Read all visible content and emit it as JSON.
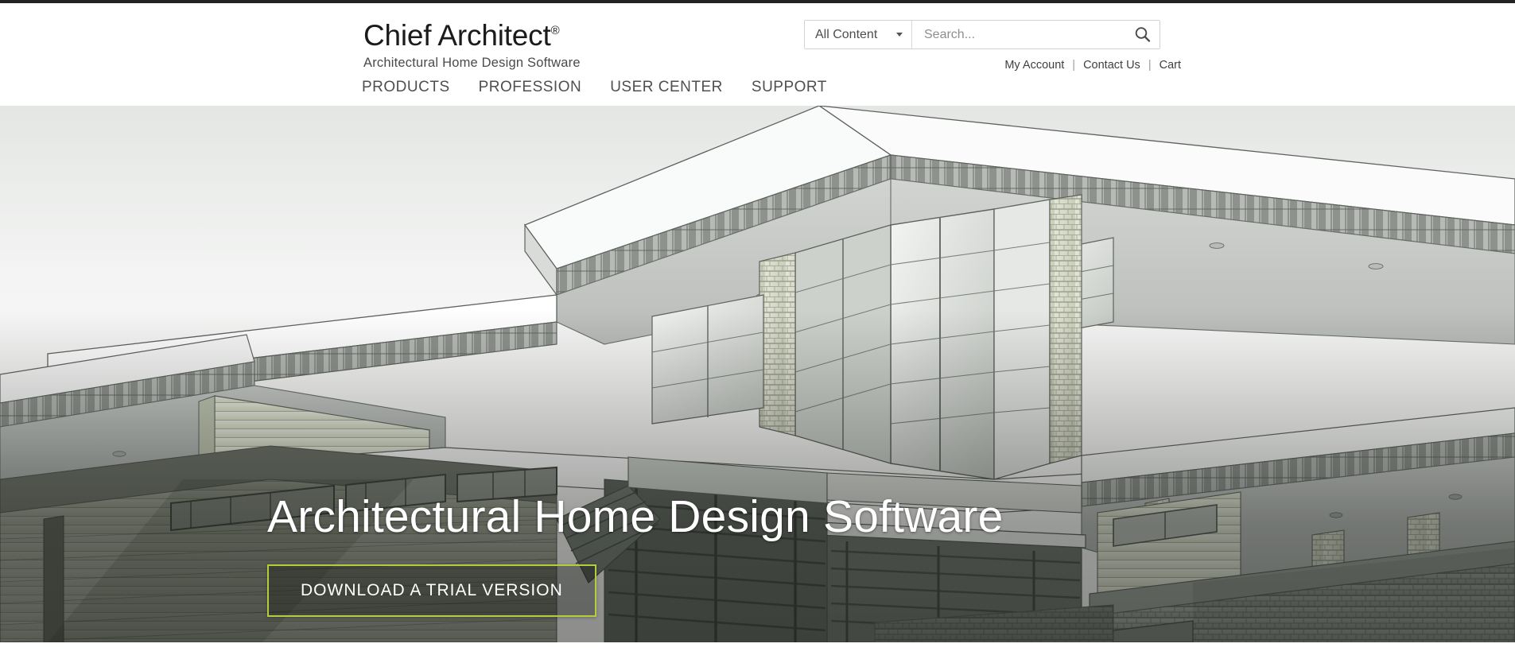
{
  "brand": {
    "name": "Chief Architect",
    "registered": "®",
    "tagline": "Architectural Home Design Software"
  },
  "search": {
    "scope_label": "All Content",
    "scope_options": [
      "All Content"
    ],
    "placeholder": "Search...",
    "value": "",
    "button_icon": "search-icon",
    "caret_icon": "chevron-down-icon"
  },
  "utility_links": {
    "my_account": "My Account",
    "separator": "|",
    "contact_us": "Contact Us",
    "cart": "Cart"
  },
  "nav": {
    "items": [
      {
        "label": "PRODUCTS"
      },
      {
        "label": "PROFESSION"
      },
      {
        "label": "USER CENTER"
      },
      {
        "label": "SUPPORT"
      }
    ]
  },
  "hero": {
    "title": "Architectural Home Design Software",
    "cta_label": "DOWNLOAD A TRIAL VERSION",
    "image_alt": "3D architectural line rendering of a modern multi-level home with flat overhanging roofs, stone columns, horizontal lap siding, glass curtain walls and a deck railing"
  },
  "colors": {
    "accent_green": "#b5cc6a",
    "cta_border_green": "#b5cc3d",
    "header_background": "#ffffff",
    "top_strip": "#222222",
    "text_dark": "#1b1b1b",
    "text_muted": "#4f4f4f",
    "hero_sky": "#f2f3f2",
    "hero_siding_green": "#dfe3d2",
    "hero_stone": "#d6d8cb",
    "hero_shadow": "#9aa09b"
  }
}
